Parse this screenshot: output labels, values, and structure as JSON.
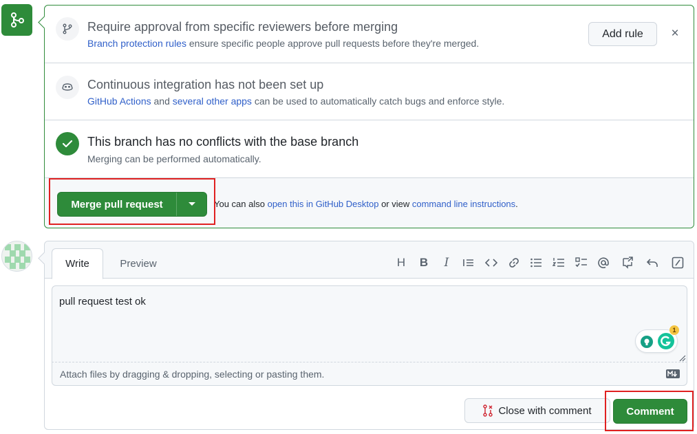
{
  "merge_status": {
    "approval": {
      "title": "Require approval from specific reviewers before merging",
      "desc_link": "Branch protection rules",
      "desc_rest": " ensure specific people approve pull requests before they're merged.",
      "add_rule_label": "Add rule",
      "close_glyph": "×"
    },
    "ci": {
      "title": "Continuous integration has not been set up",
      "link1": "GitHub Actions",
      "mid": " and ",
      "link2": "several other apps",
      "rest": " can be used to automatically catch bugs and enforce style."
    },
    "conflicts": {
      "title": "This branch has no conflicts with the base branch",
      "desc": "Merging can be performed automatically."
    },
    "merge": {
      "button_label": "Merge pull request",
      "text1": "You can also ",
      "link1": "open this in GitHub Desktop",
      "text2": " or view ",
      "link2": "command line instructions",
      "text3": "."
    }
  },
  "comment": {
    "tabs": {
      "write": "Write",
      "preview": "Preview"
    },
    "toolbar": {
      "heading_glyph": "H",
      "bold_glyph": "B",
      "italic_glyph": "I"
    },
    "body_text": "pull request test ok",
    "attach_text": "Attach files by dragging & dropping, selecting or pasting them.",
    "grammarly_count": "1",
    "close_with_comment_label": "Close with comment",
    "comment_label": "Comment"
  },
  "colors": {
    "success": "#2e8b3a",
    "link": "#2f5fc9",
    "highlight": "#e02020",
    "danger_icon": "#cf222e"
  },
  "icons": [
    "git-merge-icon",
    "git-branch-icon",
    "copilot-icon",
    "check-icon",
    "triangle-down-icon",
    "avatar-identicon",
    "heading-icon",
    "bold-icon",
    "italic-icon",
    "quote-icon",
    "code-icon",
    "link-icon",
    "unordered-list-icon",
    "ordered-list-icon",
    "task-list-icon",
    "mention-icon",
    "cross-reference-icon",
    "reply-icon",
    "slash-command-icon",
    "markdown-icon",
    "grammarly-icon",
    "git-pull-request-closed-icon"
  ]
}
